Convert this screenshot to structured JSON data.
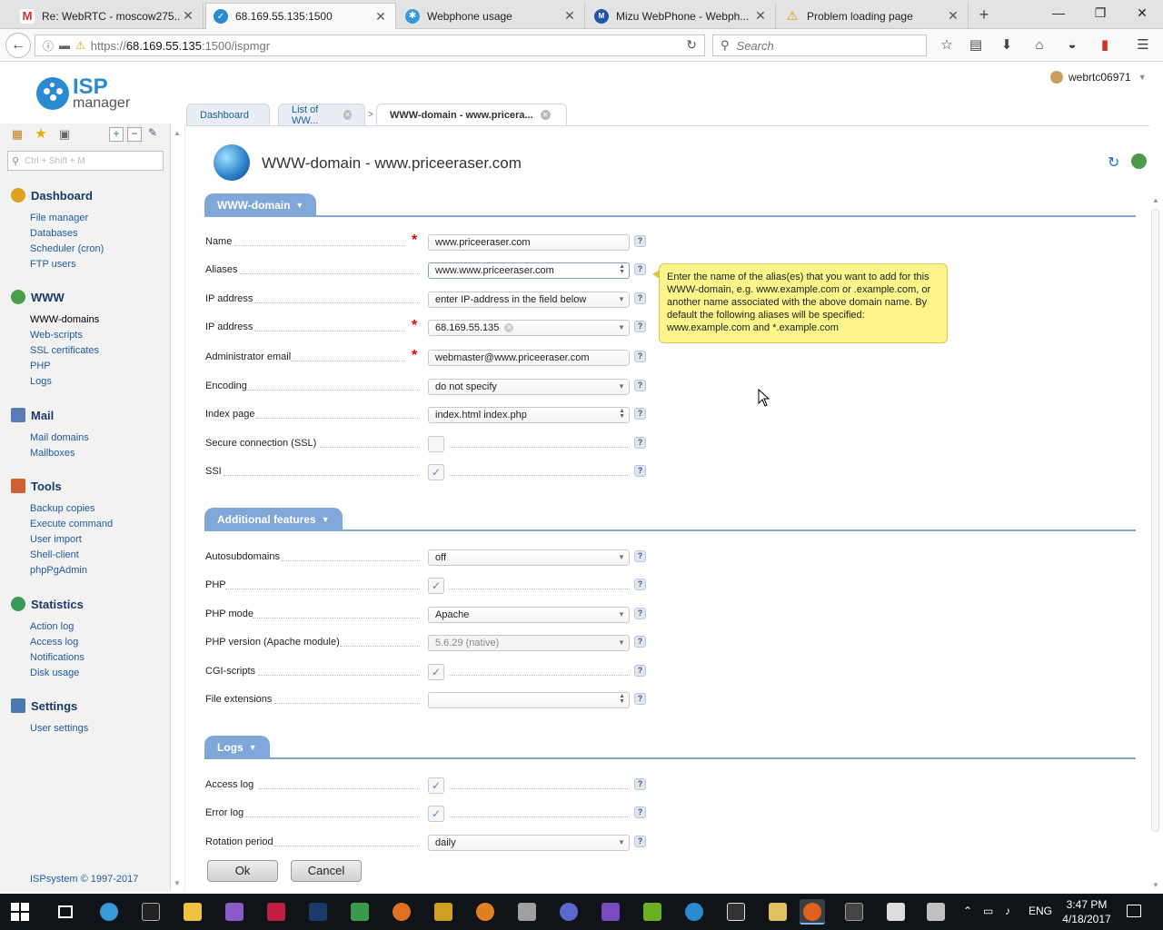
{
  "browser": {
    "tabs": [
      {
        "title": "Re: WebRTC - moscow275...",
        "icon": "gmail-icon",
        "color": "#d93025",
        "glyph": "M",
        "active": false
      },
      {
        "title": "68.169.55.135:1500",
        "icon": "isp-favicon-icon",
        "color": "#2a8ad2",
        "glyph": "✓",
        "active": true
      },
      {
        "title": "Webphone usage",
        "icon": "globe-favicon-icon",
        "color": "#3a9ad8",
        "glyph": "✱",
        "active": false
      },
      {
        "title": "Mizu WebPhone - Webph...",
        "icon": "mizu-favicon-icon",
        "color": "#2255aa",
        "glyph": "M",
        "active": false
      },
      {
        "title": "Problem loading page",
        "icon": "warning-icon",
        "color": "#e0a000",
        "glyph": "!",
        "active": false
      }
    ],
    "url_prefix": "https://",
    "url_host": "68.169.55.135",
    "url_rest": ":1500/ispmgr",
    "search_placeholder": "Search"
  },
  "app": {
    "logo_line1": "ISP",
    "logo_line2": "manager",
    "username": "webrtc06971"
  },
  "sidebar": {
    "search_placeholder": "Ctrl + Shift + M",
    "groups": [
      {
        "title": "Dashboard",
        "color": "#e0a020",
        "items": [
          "File manager",
          "Databases",
          "Scheduler (cron)",
          "FTP users"
        ]
      },
      {
        "title": "WWW",
        "color": "#4aa04a",
        "items": [
          "WWW-domains",
          "Web-scripts",
          "SSL certificates",
          "PHP",
          "Logs"
        ]
      },
      {
        "title": "Mail",
        "color": "#5a7ab8",
        "items": [
          "Mail domains",
          "Mailboxes"
        ]
      },
      {
        "title": "Tools",
        "color": "#d06030",
        "items": [
          "Backup copies",
          "Execute command",
          "User import",
          "Shell-client",
          "phpPgAdmin"
        ]
      },
      {
        "title": "Statistics",
        "color": "#3a9a5a",
        "items": [
          "Action log",
          "Access log",
          "Notifications",
          "Disk usage"
        ]
      },
      {
        "title": "Settings",
        "color": "#4a7ab0",
        "items": [
          "User settings"
        ]
      }
    ],
    "footer": "ISPsystem © 1997-2017"
  },
  "content_tabs": [
    {
      "label": "Dashboard"
    },
    {
      "label": "List of WW..."
    },
    {
      "label": "WWW-domain - www.pricera..."
    }
  ],
  "page": {
    "title": "WWW-domain - www.priceeraser.com",
    "sections": {
      "main": "WWW-domain",
      "additional": "Additional features",
      "logs": "Logs"
    },
    "fields": {
      "name": {
        "label": "Name",
        "value": "www.priceeraser.com"
      },
      "aliases": {
        "label": "Aliases",
        "value": "www.www.priceeraser.com"
      },
      "ip_mode": {
        "label": "IP address",
        "value": "enter IP-address in the field below"
      },
      "ip": {
        "label": "IP address",
        "value": "68.169.55.135"
      },
      "admin_email": {
        "label": "Administrator email",
        "value": "webmaster@www.priceeraser.com"
      },
      "encoding": {
        "label": "Encoding",
        "value": "do not specify"
      },
      "index_page": {
        "label": "Index page",
        "value": "index.html index.php"
      },
      "ssl": {
        "label": "Secure connection (SSL)",
        "checked": false
      },
      "ssi": {
        "label": "SSI",
        "checked": true
      },
      "autosubdomains": {
        "label": "Autosubdomains",
        "value": "off"
      },
      "php": {
        "label": "PHP",
        "checked": true
      },
      "php_mode": {
        "label": "PHP mode",
        "value": "Apache"
      },
      "php_version": {
        "label": "PHP version (Apache module)",
        "value": "5.6.29 (native)"
      },
      "cgi": {
        "label": "CGI-scripts",
        "checked": true
      },
      "file_ext": {
        "label": "File extensions",
        "value": ""
      },
      "access_log": {
        "label": "Access log",
        "checked": true
      },
      "error_log": {
        "label": "Error log",
        "checked": true
      },
      "rotation": {
        "label": "Rotation period",
        "value": "daily"
      }
    },
    "tooltip": "Enter the name of the alias(es) that you want to add for this WWW-domain, e.g. www.example.com or .example.com, or another name associated with the above domain name. By default the following aliases will be specified: www.example.com and *.example.com",
    "ok_label": "Ok",
    "cancel_label": "Cancel"
  },
  "taskbar": {
    "lang": "ENG",
    "time": "3:47 PM",
    "date": "4/18/2017"
  }
}
